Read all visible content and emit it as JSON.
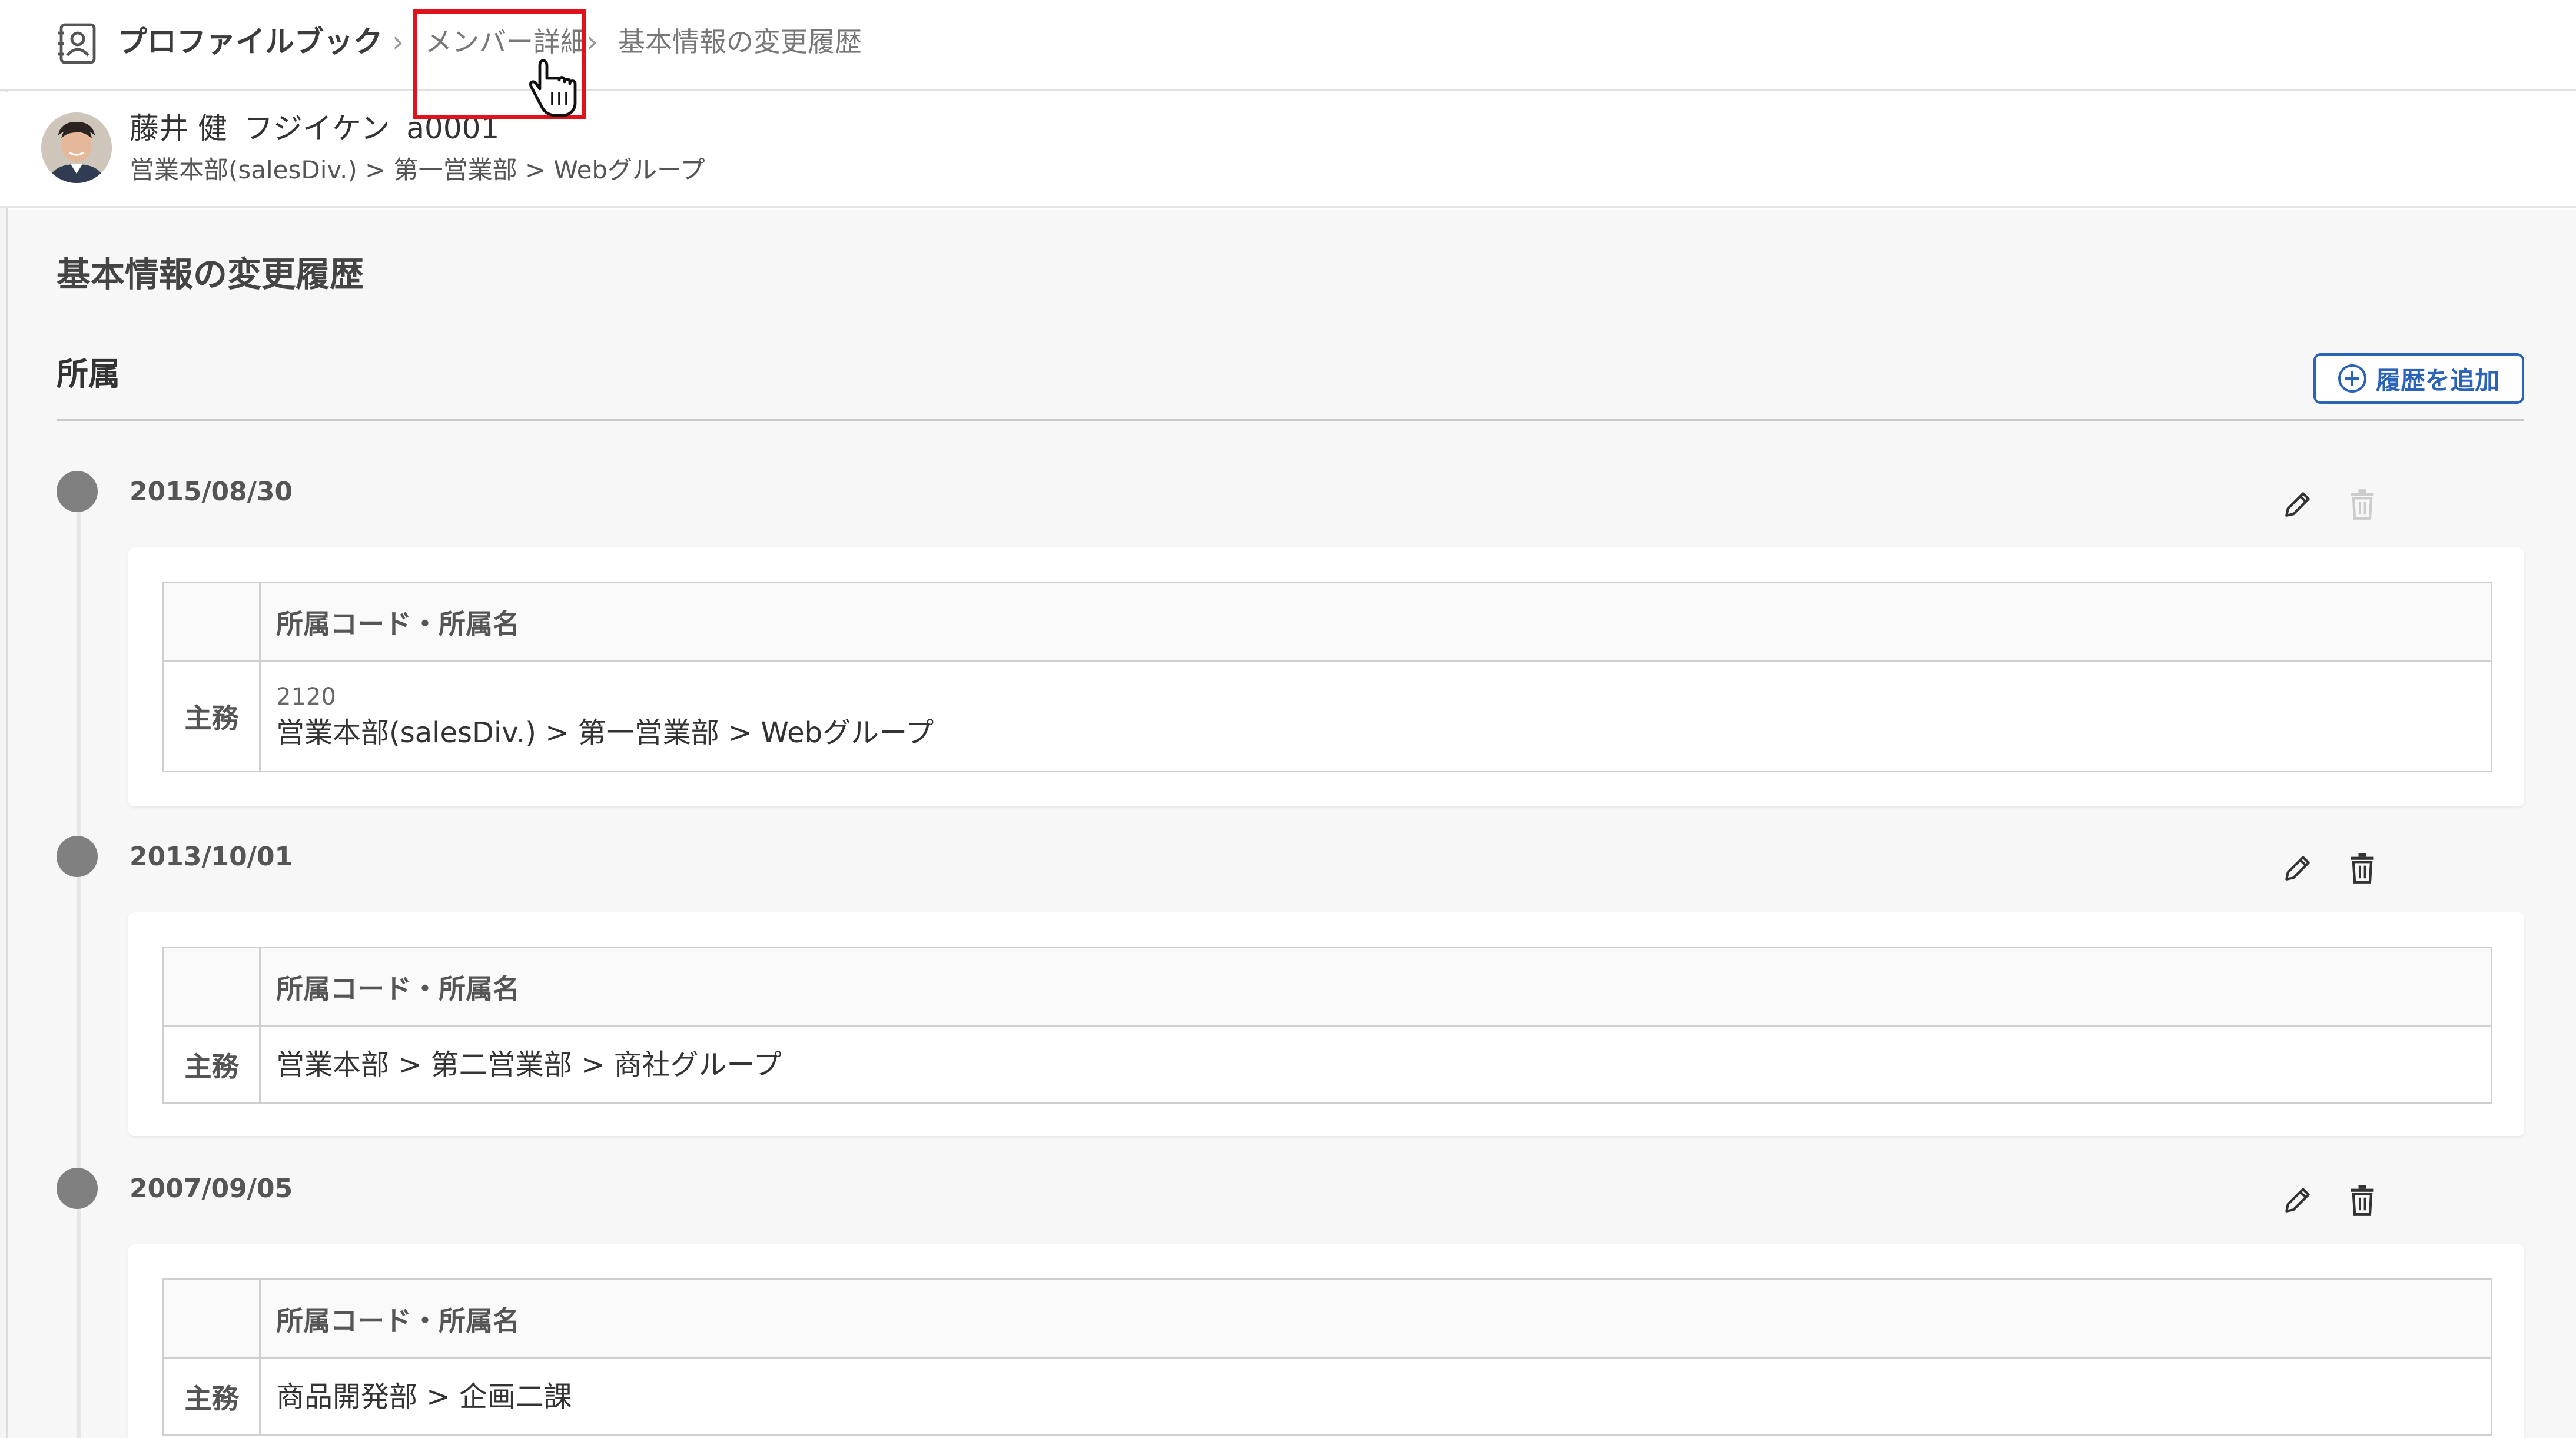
{
  "breadcrumb": {
    "app": "プロファイルブック",
    "separator": "›",
    "link": "メンバー詳細",
    "current": "基本情報の変更履歴"
  },
  "member": {
    "name": "藤井 健",
    "kana": "フジイケン",
    "code": "a0001",
    "org_path": "営業本部(salesDiv.) > 第一営業部 > Webグループ"
  },
  "page": {
    "title": "基本情報の変更履歴",
    "section": "所属",
    "add_button": "履歴を追加"
  },
  "table_header": "所属コード・所属名",
  "entries": [
    {
      "date": "2015/08/30",
      "role": "主務",
      "code": "2120",
      "org": "営業本部(salesDiv.) > 第一営業部 > Webグループ",
      "delete_enabled": false
    },
    {
      "date": "2013/10/01",
      "role": "主務",
      "code": "",
      "org": "営業本部 > 第二営業部 > 商社グループ",
      "delete_enabled": true
    },
    {
      "date": "2007/09/05",
      "role": "主務",
      "code": "",
      "org": "商品開発部 > 企画二課",
      "delete_enabled": true
    }
  ],
  "colors": {
    "accent": "#2a63b8",
    "highlight": "#e0121c",
    "dot": "#808080"
  },
  "icons": [
    "profile-book-icon",
    "hand-cursor-icon",
    "add-circle-icon",
    "pencil-icon",
    "trash-icon"
  ]
}
